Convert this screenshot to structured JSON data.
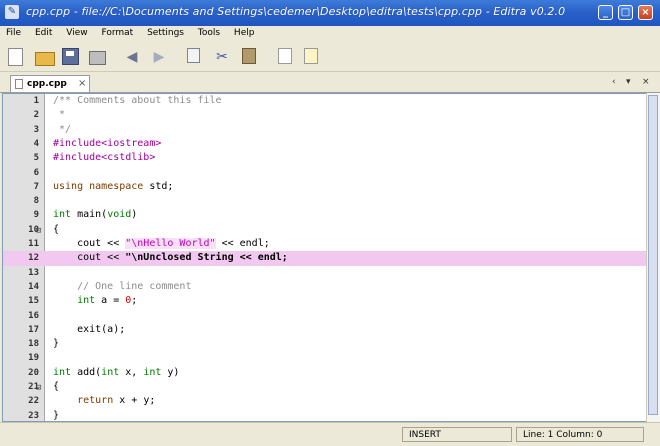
{
  "window": {
    "title": "cpp.cpp - file://C:\\Documents and Settings\\cedemer\\Desktop\\editra\\tests\\cpp.cpp - Editra v0.2.0",
    "app_icon": "editra-icon",
    "controls": {
      "minimize": "_",
      "maximize": "□",
      "close": "×"
    }
  },
  "menubar": {
    "items": [
      "File",
      "Edit",
      "View",
      "Format",
      "Settings",
      "Tools",
      "Help"
    ]
  },
  "toolbar": {
    "buttons": [
      "new-file-icon",
      "open-folder-icon",
      "save-icon",
      "print-icon",
      "undo-icon",
      "redo-icon",
      "copy-icon",
      "cut-icon",
      "paste-icon",
      "find-icon",
      "find-replace-icon"
    ]
  },
  "tabs": {
    "active_label": "cpp.cpp",
    "close_glyph": "×",
    "nav_left": "‹",
    "nav_menu": "▾",
    "nav_close": "×"
  },
  "editor": {
    "lines": [
      {
        "n": "1",
        "code": "/** Comments about this file"
      },
      {
        "n": "2",
        "code": " *"
      },
      {
        "n": "3",
        "code": " */"
      },
      {
        "n": "4",
        "code": "#include<iostream>"
      },
      {
        "n": "5",
        "code": "#include<cstdlib>"
      },
      {
        "n": "6",
        "code": ""
      },
      {
        "n": "7",
        "code": "using namespace std;"
      },
      {
        "n": "8",
        "code": ""
      },
      {
        "n": "9",
        "code": "int main(void)"
      },
      {
        "n": "10",
        "code": "{"
      },
      {
        "n": "11",
        "code": "    cout << \"\\nHello World\" << endl;"
      },
      {
        "n": "12",
        "code": "    cout << \"\\nUnclosed String << endl;"
      },
      {
        "n": "13",
        "code": ""
      },
      {
        "n": "14",
        "code": "    // One line comment"
      },
      {
        "n": "15",
        "code": "    int a = 0;"
      },
      {
        "n": "16",
        "code": ""
      },
      {
        "n": "17",
        "code": "    exit(a);"
      },
      {
        "n": "18",
        "code": "}"
      },
      {
        "n": "19",
        "code": ""
      },
      {
        "n": "20",
        "code": "int add(int x, int y)"
      },
      {
        "n": "21",
        "code": "{"
      },
      {
        "n": "22",
        "code": "    return x + y;"
      },
      {
        "n": "23",
        "code": "}"
      }
    ],
    "fold_markers": {
      "10": "⊟",
      "21": "⊟"
    },
    "highlighted_line": "12"
  },
  "statusbar": {
    "mode": "INSERT",
    "position": "Line: 1  Column: 0"
  },
  "colors": {
    "titlebar": "#2a62c9",
    "highlight_line": "#f1c8f0",
    "preprocessor": "#a000a0",
    "keyword": "#7b3b00",
    "type": "#007b00",
    "string": "#c000c0",
    "number": "#d80000",
    "comment": "#8c8c8c"
  }
}
